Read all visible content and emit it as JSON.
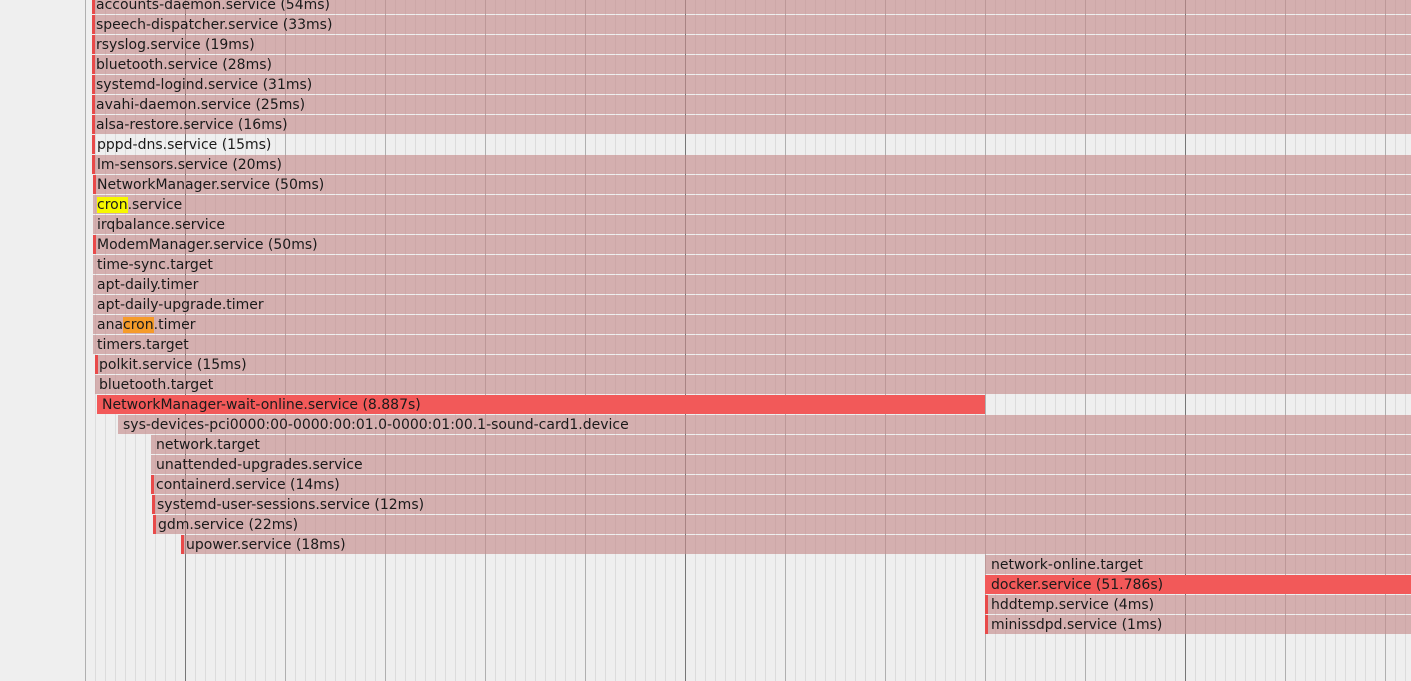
{
  "chart_data": {
    "type": "bootchart-timeline",
    "units": [
      {
        "label": "accounts-daemon.service (54ms)",
        "active": true
      },
      {
        "label": "speech-dispatcher.service (33ms)",
        "active": true
      },
      {
        "label": "rsyslog.service (19ms)",
        "active": true
      },
      {
        "label": "bluetooth.service (28ms)",
        "active": true
      },
      {
        "label": "systemd-logind.service (31ms)",
        "active": true
      },
      {
        "label": "avahi-daemon.service (25ms)",
        "active": true
      },
      {
        "label": "alsa-restore.service (16ms)",
        "active": true
      },
      {
        "label": "pppd-dns.service (15ms)",
        "active": true
      },
      {
        "label": "lm-sensors.service (20ms)",
        "active": true
      },
      {
        "label": "NetworkManager.service (50ms)",
        "active": true
      },
      {
        "label": "cron.service",
        "highlight": "cron",
        "highlight_color": "#f7f700"
      },
      {
        "label": "irqbalance.service"
      },
      {
        "label": "ModemManager.service (50ms)",
        "active": true
      },
      {
        "label": "time-sync.target"
      },
      {
        "label": "apt-daily.timer"
      },
      {
        "label": "apt-daily-upgrade.timer"
      },
      {
        "label": "anacron.timer",
        "highlight": "cron",
        "highlight_color": "#f59b2a"
      },
      {
        "label": "timers.target"
      },
      {
        "label": "polkit.service (15ms)",
        "active": true
      },
      {
        "label": "bluetooth.target"
      },
      {
        "label": "NetworkManager-wait-online.service (8.887s)",
        "duration_s": 8.887
      },
      {
        "label": "sys-devices-pci0000:00-0000:00:01.0-0000:01:00.1-sound-card1.device"
      },
      {
        "label": "network.target"
      },
      {
        "label": "unattended-upgrades.service"
      },
      {
        "label": "containerd.service (14ms)",
        "active": true
      },
      {
        "label": "systemd-user-sessions.service (12ms)",
        "active": true
      },
      {
        "label": "gdm.service (22ms)",
        "active": true
      },
      {
        "label": "upower.service (18ms)",
        "active": true
      },
      {
        "label": "network-online.target"
      },
      {
        "label": "docker.service (51.786s)",
        "duration_s": 51.786
      },
      {
        "label": "hddtemp.service (4ms)",
        "active": true
      },
      {
        "label": "minissdpd.service (1ms)",
        "active": true
      }
    ],
    "colors": {
      "bar": "#d4acac",
      "long_bar": "#f25959",
      "active_marker": "#e84a4a",
      "background": "#efefef"
    },
    "grid": true
  }
}
